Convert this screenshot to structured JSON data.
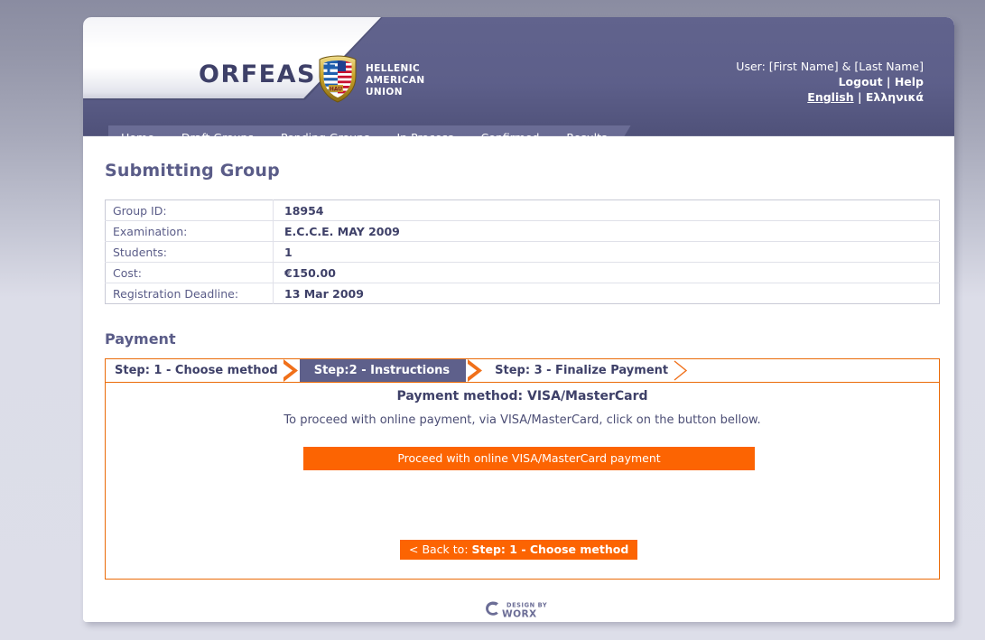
{
  "brand": {
    "name": "ORFEAS",
    "org_line1": "HELLENIC",
    "org_line2": "AMERICAN",
    "org_line3": "UNION",
    "shield_icon": "hau-shield-icon"
  },
  "header": {
    "user_label": "User: [First Name] & [Last Name]",
    "logout": "Logout",
    "sep1": " | ",
    "help": "Help",
    "lang_en": "English",
    "sep2": " | ",
    "lang_el": "Ελληνικά"
  },
  "nav": {
    "tabs": [
      {
        "label": "Home"
      },
      {
        "label": "Draft Groups"
      },
      {
        "label": "Pending Groups"
      },
      {
        "label": "In Process"
      },
      {
        "label": "Confirmed"
      },
      {
        "label": "Results"
      }
    ]
  },
  "main": {
    "page_title": "Submitting Group",
    "info_rows": [
      {
        "label": "Group ID:",
        "value": "18954"
      },
      {
        "label": "Examination:",
        "value": "E.C.C.E. MAY 2009"
      },
      {
        "label": "Students:",
        "value": "1"
      },
      {
        "label": "Cost:",
        "value": "€150.00"
      },
      {
        "label": "Registration Deadline:",
        "value": "13 Mar 2009"
      }
    ]
  },
  "payment": {
    "section_title": "Payment",
    "steps": [
      {
        "label": "Step: 1 - Choose method",
        "active": false
      },
      {
        "label": "Step:2 - Instructions",
        "active": true
      },
      {
        "label": "Step: 3 - Finalize Payment",
        "active": false
      }
    ],
    "method_title": "Payment method: VISA/MasterCard",
    "description": "To proceed with online payment, via VISA/MasterCard, click on the button bellow.",
    "proceed_label": "Proceed with online VISA/MasterCard payment",
    "back_prefix": "< Back to: ",
    "back_target": "Step: 1 - Choose method"
  },
  "footer": {
    "design_by": "DESIGN BY",
    "vendor": "WORX"
  },
  "colors": {
    "header_purple": "#5e608b",
    "accent_orange": "#fc6402",
    "border_orange": "#ea6b08",
    "text_purple": "#3e4068"
  }
}
